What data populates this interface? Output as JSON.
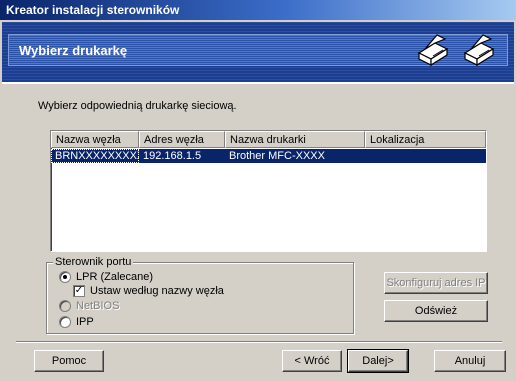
{
  "window": {
    "title": "Kreator instalacji sterowników"
  },
  "banner": {
    "title": "Wybierz drukarkę"
  },
  "instruction": "Wybierz odpowiednią drukarkę sieciową.",
  "printer_list": {
    "columns": [
      "Nazwa węzła",
      "Adres węzła",
      "Nazwa drukarki",
      "Lokalizacja"
    ],
    "rows": [
      {
        "node_name": "BRNXXXXXXXXX",
        "node_address": "192.168.1.5",
        "printer_name": "Brother MFC-XXXX",
        "location": "",
        "selected": true
      }
    ]
  },
  "port_driver": {
    "label": "Sterownik portu",
    "lpr_label": "LPR (Zalecane)",
    "lpr_selected": true,
    "node_name_label": "Ustaw według nazwy węzła",
    "node_name_checked": true,
    "netbios_label": "NetBIOS",
    "netbios_enabled": false,
    "ipp_label": "IPP"
  },
  "buttons": {
    "configure_ip": "Skonfiguruj adres IP",
    "refresh": "Odśwież",
    "help": "Pomoc",
    "back": "< Wróć",
    "next": "Dalej>",
    "cancel": "Anuluj"
  },
  "icons": [
    "printer-icon",
    "printer-icon"
  ],
  "colors": {
    "titlebar": "#0a246a",
    "banner": "#1c3e93",
    "selection": "#0a246a"
  }
}
